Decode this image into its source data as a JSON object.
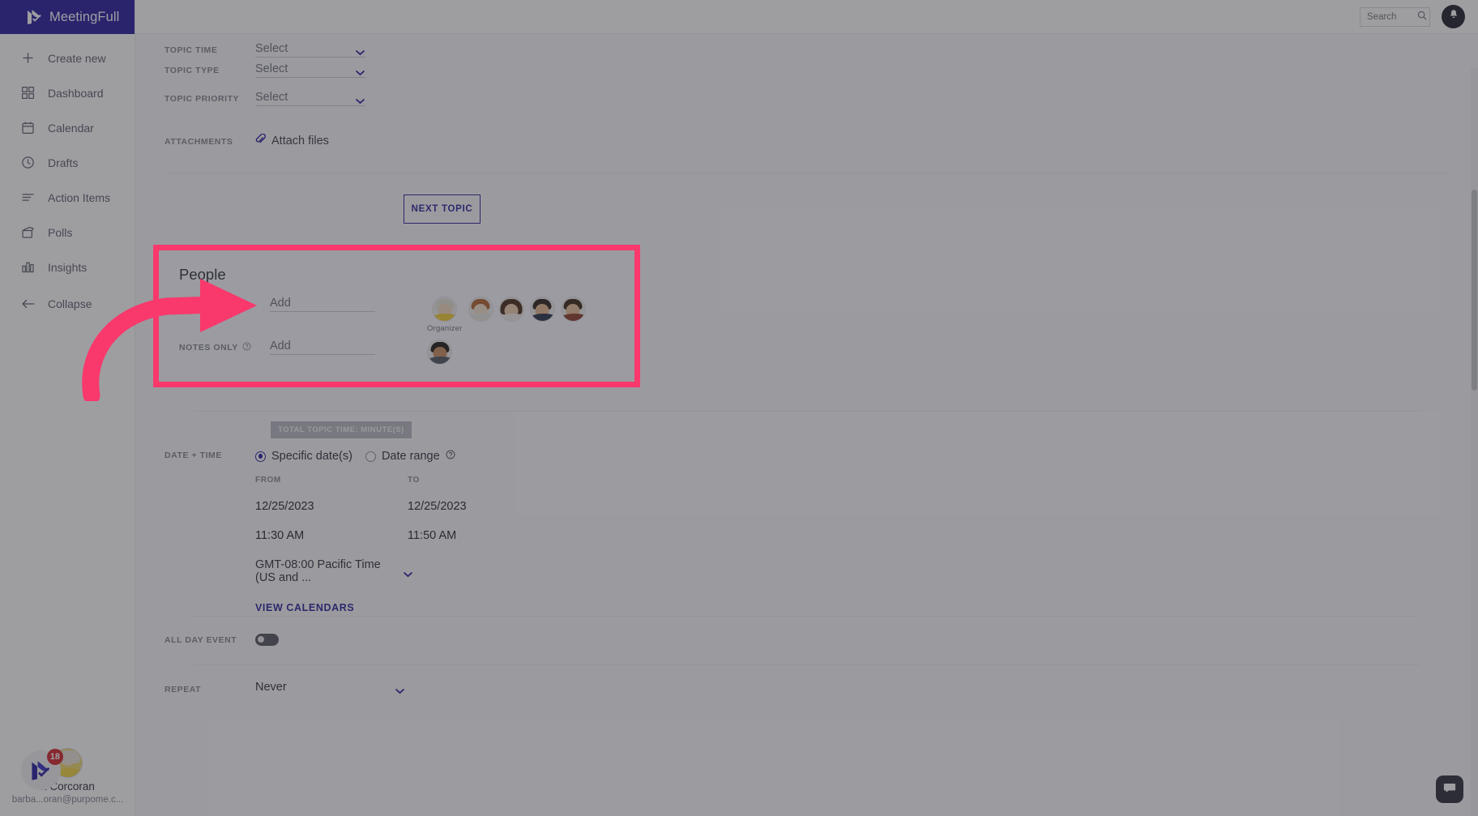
{
  "brand": {
    "name": "MeetingFull",
    "logo_icon": "meetingfull-logo-icon"
  },
  "topbar": {
    "search": {
      "placeholder": "Search",
      "value": "",
      "icon": "search-icon"
    },
    "notifications_icon": "bell-icon"
  },
  "sidebar": {
    "items": [
      {
        "label": "Create new",
        "icon": "plus-icon"
      },
      {
        "label": "Dashboard",
        "icon": "grid-icon"
      },
      {
        "label": "Calendar",
        "icon": "calendar-icon"
      },
      {
        "label": "Drafts",
        "icon": "clock-icon"
      },
      {
        "label": "Action Items",
        "icon": "list-lines-icon"
      },
      {
        "label": "Polls",
        "icon": "polls-icon"
      },
      {
        "label": "Insights",
        "icon": "bar-chart-icon"
      },
      {
        "label": "Collapse",
        "icon": "arrow-left-icon"
      }
    ],
    "user": {
      "name": "a Corcoran",
      "email": "barba...oran@purpome.c...",
      "avatar_icon": "user-avatar",
      "badge_count": "18",
      "badge_icon": "meetingfull-logo-icon"
    }
  },
  "form": {
    "topic_time": {
      "label": "TOPIC TIME",
      "value": "Select",
      "chevron": "chevron-down-icon"
    },
    "topic_type": {
      "label": "TOPIC TYPE",
      "value": "Select",
      "chevron": "chevron-down-icon"
    },
    "topic_priority": {
      "label": "TOPIC PRIORITY",
      "value": "Select",
      "chevron": "chevron-down-icon"
    },
    "attachments": {
      "label": "ATTACHMENTS",
      "link": "Attach files",
      "icon": "paperclip-icon"
    },
    "next_topic_button": "NEXT TOPIC"
  },
  "people": {
    "title": "People",
    "participants_row": {
      "add_label": "Add",
      "organizer_caption": "Organizer",
      "avatar_count": 5
    },
    "notes_only_row": {
      "label": "NOTES ONLY",
      "help_icon": "question-circle-icon",
      "add_label": "Add",
      "avatar_count": 1
    }
  },
  "datetime": {
    "total_topic_time_badge": "TOTAL TOPIC TIME: MINUTE(S)",
    "label": "DATE + TIME",
    "options": [
      {
        "label": "Specific date(s)",
        "selected": true
      },
      {
        "label": "Date range",
        "selected": false,
        "help_icon": "question-circle-icon"
      }
    ],
    "from": {
      "label": "FROM",
      "date": "12/25/2023",
      "time": "11:30 AM"
    },
    "to": {
      "label": "TO",
      "date": "12/25/2023",
      "time": "11:50 AM"
    },
    "timezone": {
      "value": "GMT-08:00 Pacific Time (US and ...",
      "chevron": "chevron-down-icon"
    },
    "view_calendars": "VIEW CALENDARS"
  },
  "all_day_event": {
    "label": "ALL DAY EVENT",
    "enabled": false
  },
  "repeat": {
    "label": "REPEAT",
    "value": "Never",
    "chevron": "chevron-down-icon"
  },
  "chat_widget_icon": "chat-bubble-icon",
  "colors": {
    "brand_purple": "#251a9e",
    "highlight_pink": "#f9386c",
    "badge_red": "#d22028",
    "dim_overlay": "rgba(49,49,56,0.47)"
  }
}
